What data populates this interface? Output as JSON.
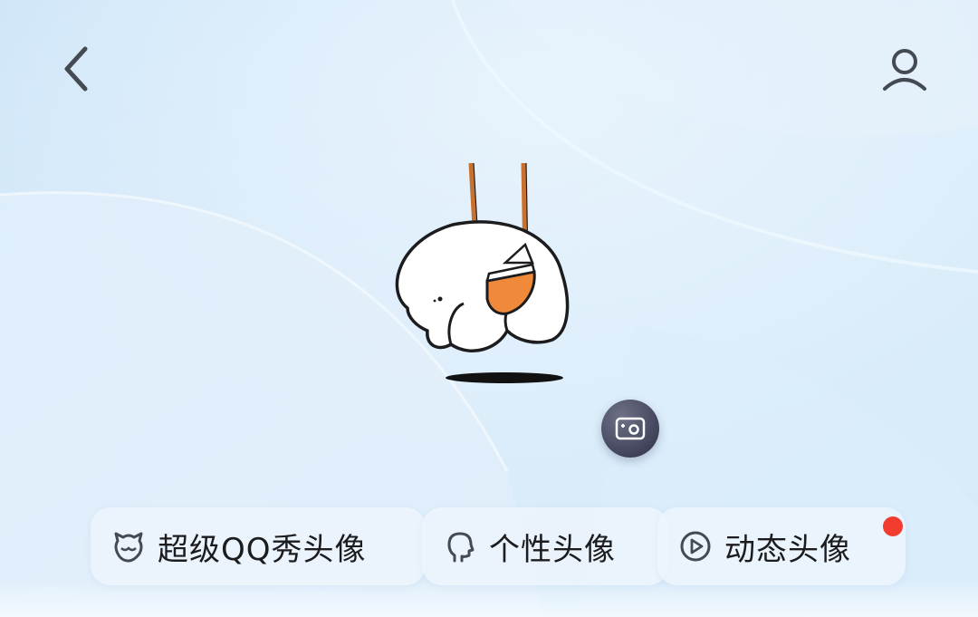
{
  "tabs": [
    {
      "id": "super-qq-show",
      "label": "超级QQ秀头像",
      "icon": "qq-show-face-icon"
    },
    {
      "id": "personal",
      "label": "个性头像",
      "icon": "head-profile-icon"
    },
    {
      "id": "dynamic",
      "label": "动态头像",
      "icon": "play-circle-icon",
      "badge": "red-dot"
    }
  ],
  "icons": {
    "back": "chevron-left-icon",
    "profile": "user-icon",
    "camera": "camera-icon"
  },
  "colors": {
    "background": "#d9ecfa",
    "badge": "#f23c2f",
    "tab_bg": "#ecf5fc",
    "text": "#1c1c1e",
    "swing_rope": "#c9712e",
    "seat_orange": "#f08a3a"
  }
}
